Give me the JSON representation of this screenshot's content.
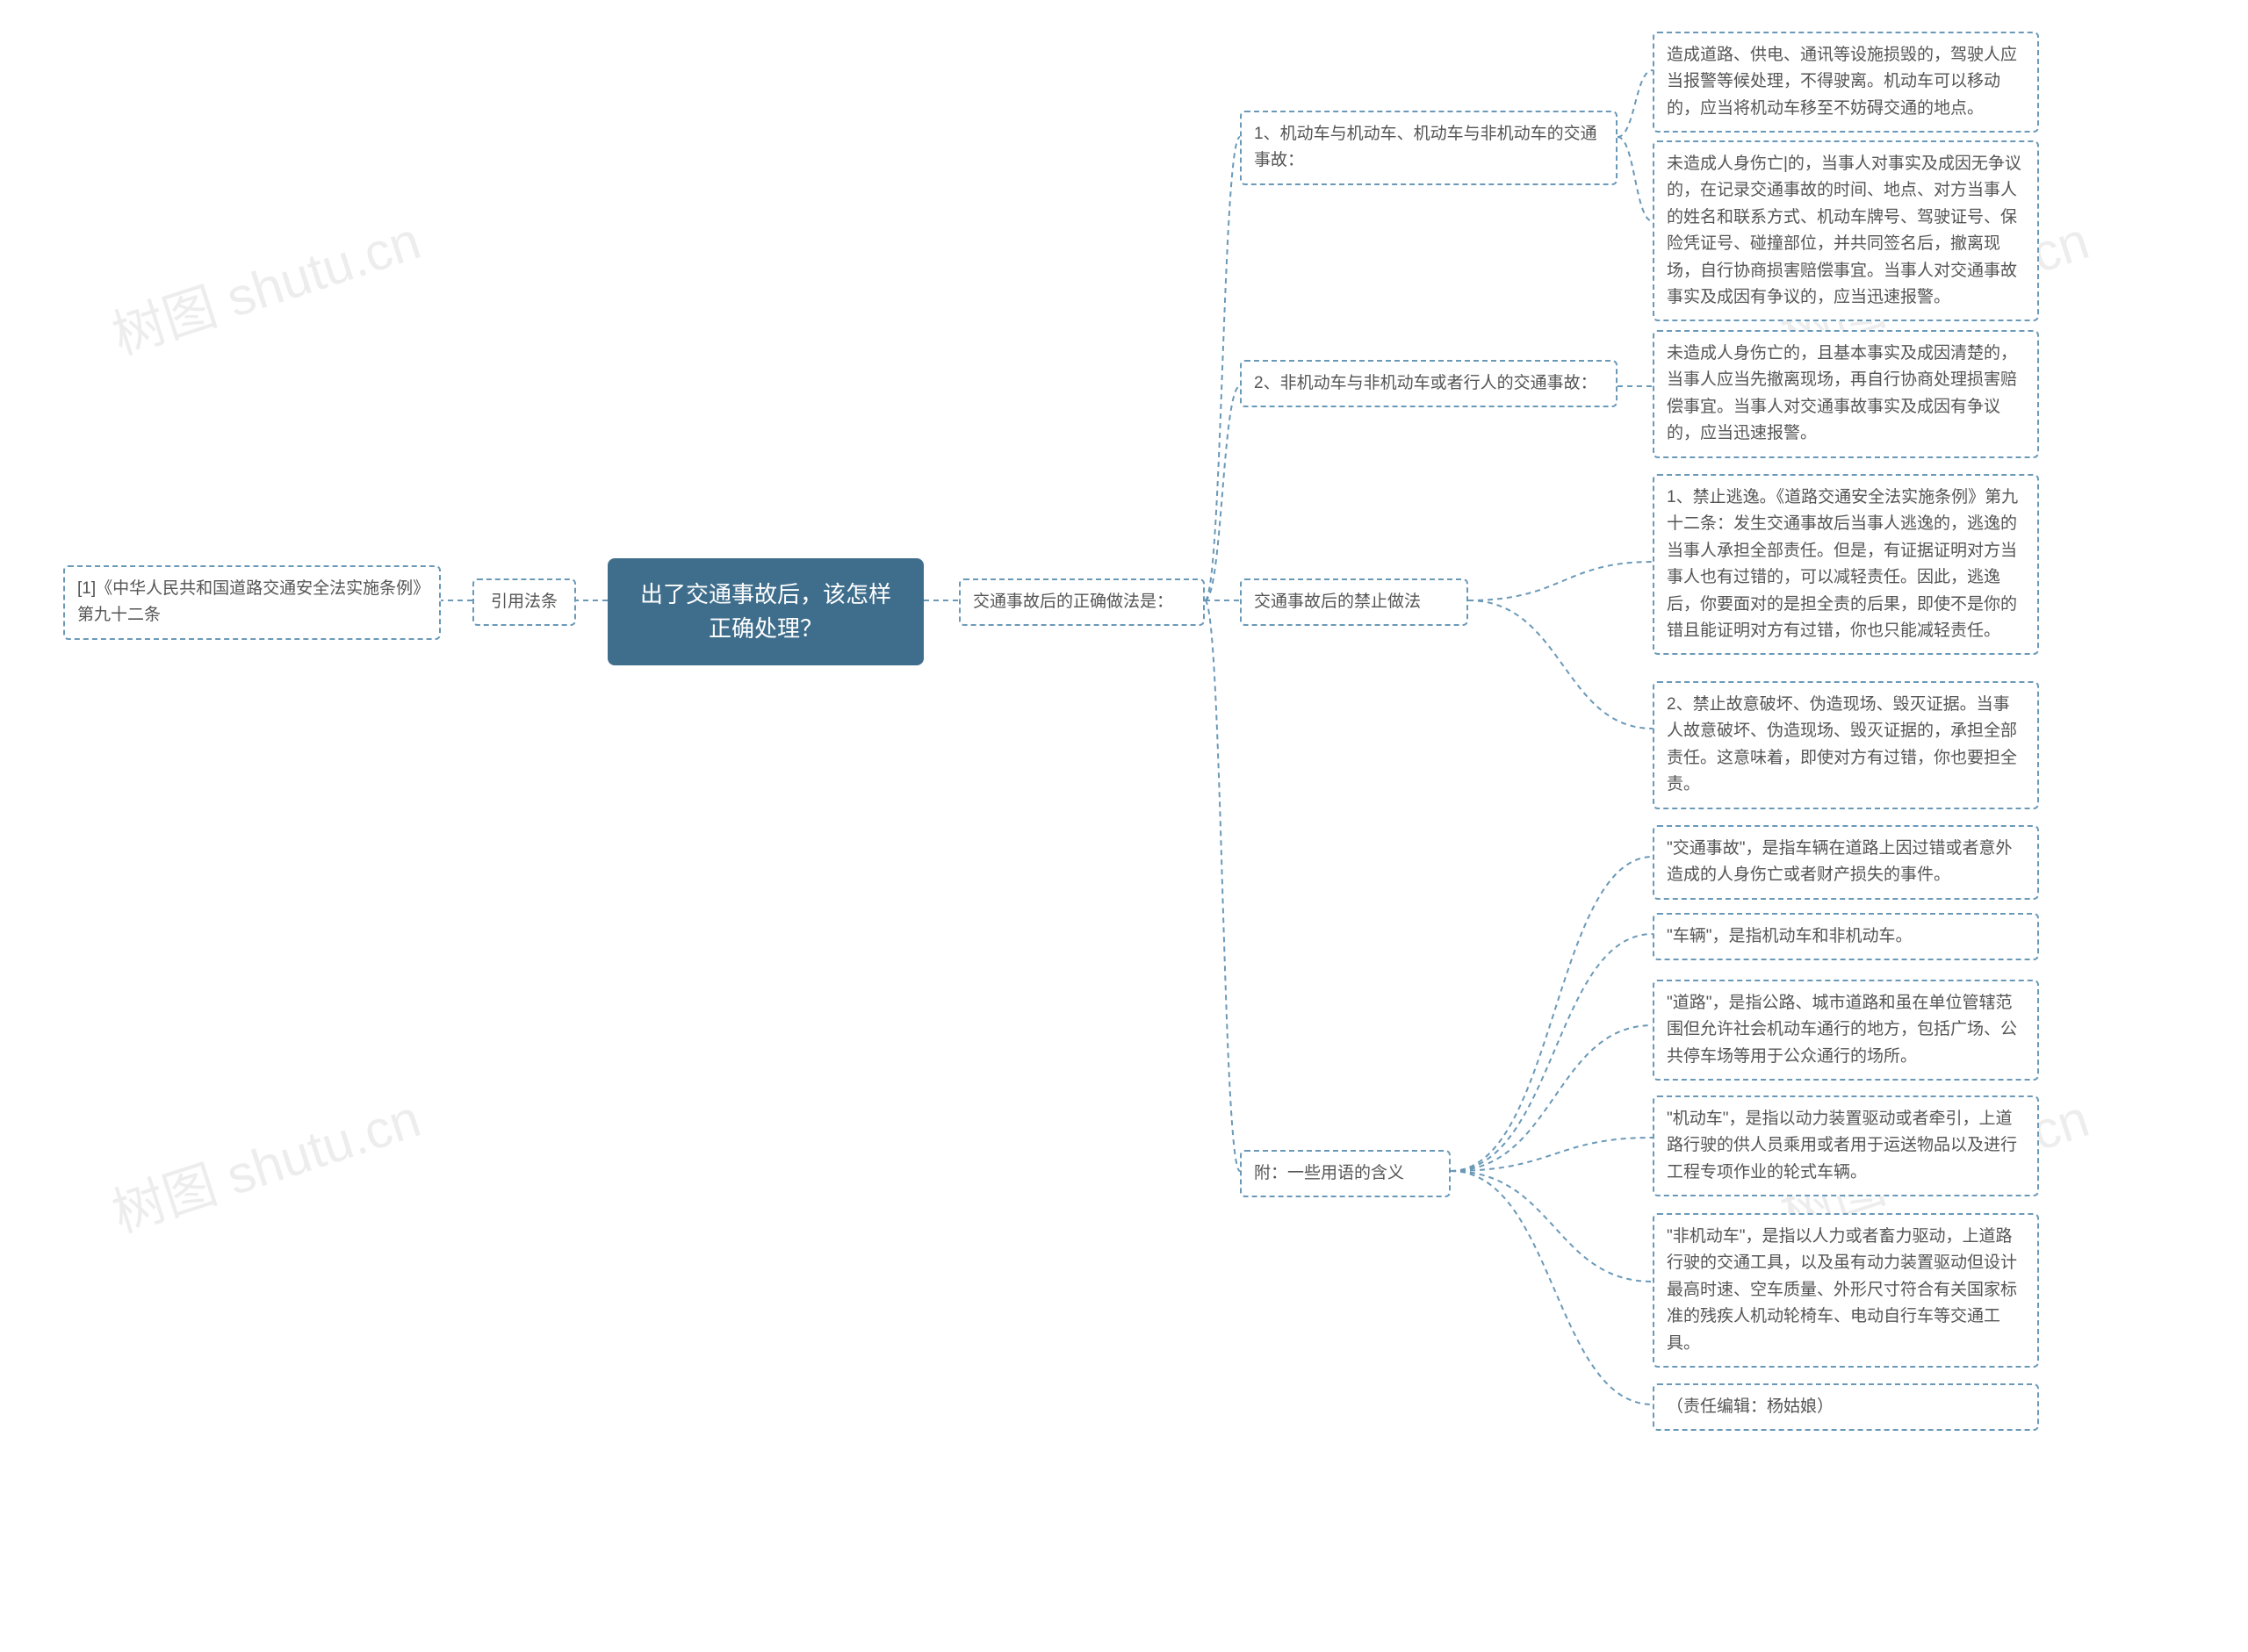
{
  "watermark": "树图 shutu.cn",
  "root": {
    "title_l1": "出了交通事故后，该怎样",
    "title_l2": "正确处理？"
  },
  "left": {
    "branch1_label": "引用法条",
    "branch1_item": "[1]《中华人民共和国道路交通安全法实施条例》第九十二条"
  },
  "right": {
    "main_label": "交通事故后的正确做法是：",
    "sec1": {
      "label": "1、机动车与机动车、机动车与非机动车的交通事故：",
      "item1": "造成道路、供电、通讯等设施损毁的，驾驶人应当报警等候处理，不得驶离。机动车可以移动的，应当将机动车移至不妨碍交通的地点。",
      "item2": "未造成人身伤亡|的，当事人对事实及成因无争议的，在记录交通事故的时间、地点、对方当事人的姓名和联系方式、机动车牌号、驾驶证号、保险凭证号、碰撞部位，并共同签名后，撤离现场，自行协商损害赔偿事宜。当事人对交通事故事实及成因有争议的，应当迅速报警。"
    },
    "sec2": {
      "label": "2、非机动车与非机动车或者行人的交通事故：",
      "item1": "未造成人身伤亡的，且基本事实及成因清楚的，当事人应当先撤离现场，再自行协商处理损害赔偿事宜。当事人对交通事故事实及成因有争议的，应当迅速报警。"
    },
    "sec3": {
      "label": "交通事故后的禁止做法",
      "item1": "1、禁止逃逸。《道路交通安全法实施条例》第九十二条：发生交通事故后当事人逃逸的，逃逸的当事人承担全部责任。但是，有证据证明对方当事人也有过错的，可以减轻责任。因此，逃逸后，你要面对的是担全责的后果，即使不是你的错且能证明对方有过错，你也只能减轻责任。",
      "item2": "2、禁止故意破坏、伪造现场、毁灭证据。当事人故意破坏、伪造现场、毁灭证据的，承担全部责任。这意味着，即使对方有过错，你也要担全责。"
    },
    "sec4": {
      "label": "附：一些用语的含义",
      "item1": "\"交通事故\"，是指车辆在道路上因过错或者意外造成的人身伤亡或者财产损失的事件。",
      "item2": "\"车辆\"，是指机动车和非机动车。",
      "item3": "\"道路\"，是指公路、城市道路和虽在单位管辖范围但允许社会机动车通行的地方，包括广场、公共停车场等用于公众通行的场所。",
      "item4": "\"机动车\"，是指以动力装置驱动或者牵引，上道路行驶的供人员乘用或者用于运送物品以及进行工程专项作业的轮式车辆。",
      "item5": "\"非机动车\"，是指以人力或者畜力驱动，上道路行驶的交通工具，以及虽有动力装置驱动但设计最高时速、空车质量、外形尺寸符合有关国家标准的残疾人机动轮椅车、电动自行车等交通工具。",
      "item6": "（责任编辑：杨姑娘）"
    }
  }
}
